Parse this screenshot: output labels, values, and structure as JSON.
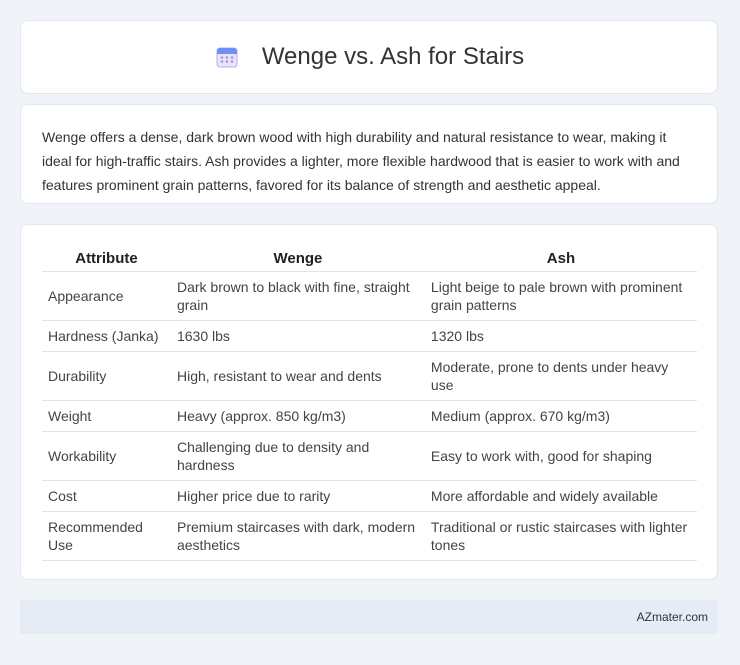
{
  "header": {
    "title": "Wenge vs. Ash for Stairs",
    "icon": "calendar-icon"
  },
  "summary": {
    "text": "Wenge offers a dense, dark brown wood with high durability and natural resistance to wear, making it ideal for high-traffic stairs. Ash provides a lighter, more flexible hardwood that is easier to work with and features prominent grain patterns, favored for its balance of strength and aesthetic appeal."
  },
  "table": {
    "headers": [
      "Attribute",
      "Wenge",
      "Ash"
    ],
    "rows": [
      [
        "Appearance",
        "Dark brown to black with fine, straight grain",
        "Light beige to pale brown with prominent grain patterns"
      ],
      [
        "Hardness (Janka)",
        "1630 lbs",
        "1320 lbs"
      ],
      [
        "Durability",
        "High, resistant to wear and dents",
        "Moderate, prone to dents under heavy use"
      ],
      [
        "Weight",
        "Heavy (approx. 850 kg/m3)",
        "Medium (approx. 670 kg/m3)"
      ],
      [
        "Workability",
        "Challenging due to density and hardness",
        "Easy to work with, good for shaping"
      ],
      [
        "Cost",
        "Higher price due to rarity",
        "More affordable and widely available"
      ],
      [
        "Recommended Use",
        "Premium staircases with dark, modern aesthetics",
        "Traditional or rustic staircases with lighter tones"
      ]
    ]
  },
  "footer": {
    "source": "AZmater.com"
  }
}
